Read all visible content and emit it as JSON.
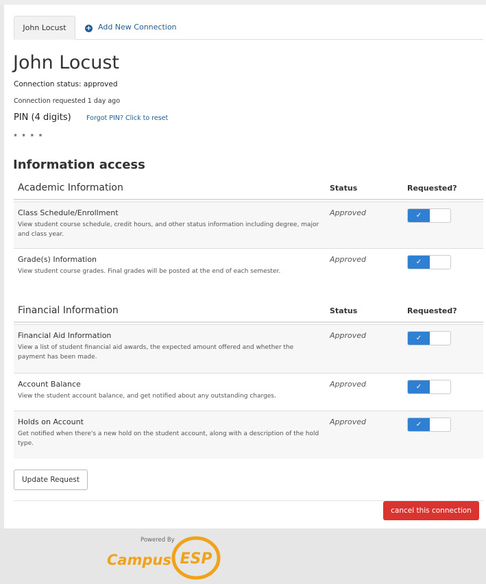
{
  "tabs": {
    "active": "John Locust",
    "add_new": "Add New Connection"
  },
  "connection": {
    "name": "John Locust",
    "status": "Connection status: approved",
    "requested": "Connection requested 1 day ago",
    "pin_label": "PIN (4 digits)",
    "pin_reset": "Forgot PIN? Click to reset",
    "pin_value": "* * * *"
  },
  "info_access": {
    "heading": "Information access",
    "status_header": "Status",
    "requested_header": "Requested?",
    "toggle_check": "✓",
    "academic": {
      "title": "Academic Information",
      "rows": [
        {
          "title": "Class Schedule/Enrollment",
          "desc": "View student course schedule, credit hours, and other status information including degree, major and class year.",
          "status": "Approved"
        },
        {
          "title": "Grade(s) Information",
          "desc": "View student course grades. Final grades will be posted at the end of each semester.",
          "status": "Approved"
        }
      ]
    },
    "financial": {
      "title": "Financial Information",
      "rows": [
        {
          "title": "Financial Aid Information",
          "desc": "View a list of student financial aid awards, the expected amount offered and whether the payment has been made.",
          "status": "Approved"
        },
        {
          "title": "Account Balance",
          "desc": "View the student account balance, and get notified about any outstanding charges.",
          "status": "Approved"
        },
        {
          "title": "Holds on Account",
          "desc": "Get notified when there's a new hold on the student account, along with a description of the hold type.",
          "status": "Approved"
        }
      ]
    }
  },
  "actions": {
    "update": "Update Request",
    "cancel": "cancel this connection"
  },
  "footer": {
    "powered_by": "Powered By",
    "brand": "Campus",
    "brand_mark": "ESP"
  },
  "colors": {
    "primary": "#2f7fd3",
    "danger": "#d9342f",
    "brand": "#f0a31a",
    "link": "#245c8f"
  }
}
